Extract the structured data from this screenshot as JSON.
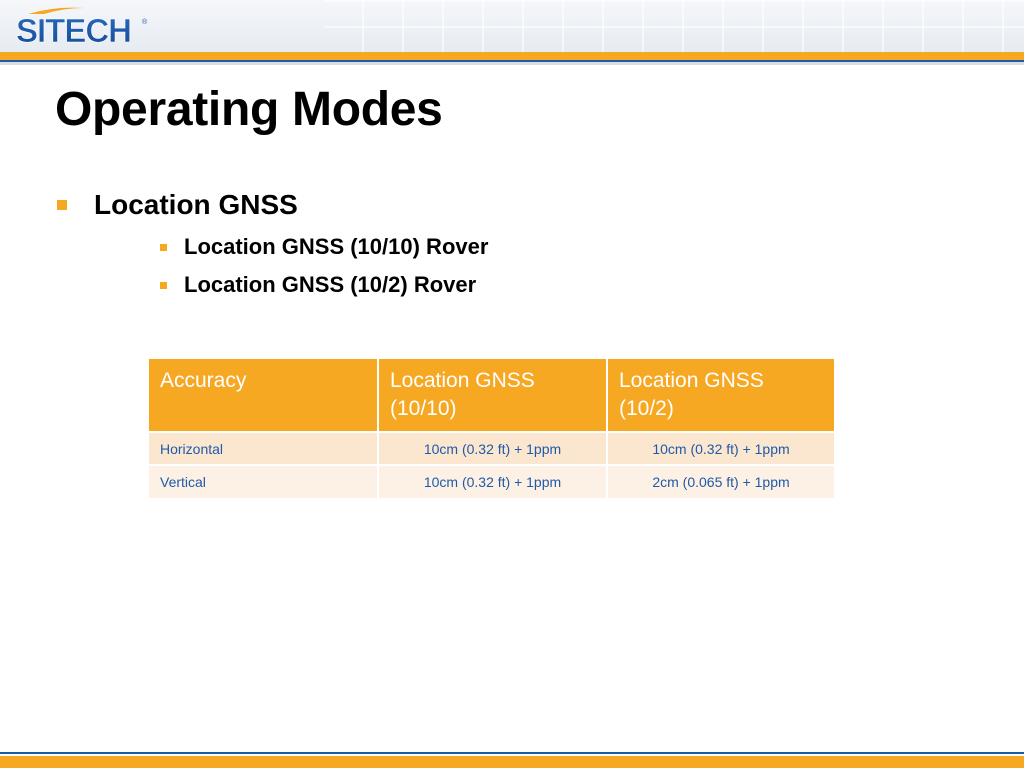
{
  "header": {
    "logo_text": "SITECH",
    "colors": {
      "orange": "#f7a823",
      "blue": "#1f5aa8"
    }
  },
  "slide": {
    "title": "Operating Modes",
    "bullet_level1": "Location GNSS",
    "bullets_level2": [
      "Location GNSS (10/10) Rover",
      "Location GNSS (10/2) Rover"
    ]
  },
  "table": {
    "headers": [
      "Accuracy",
      "Location GNSS (10/10)",
      "Location GNSS (10/2)"
    ],
    "rows": [
      {
        "label": "Horizontal",
        "c1": "10cm (0.32 ft) + 1ppm",
        "c2": "10cm (0.32 ft) + 1ppm"
      },
      {
        "label": "Vertical",
        "c1": "10cm (0.32 ft) + 1ppm",
        "c2": "2cm (0.065 ft) + 1ppm"
      }
    ]
  }
}
